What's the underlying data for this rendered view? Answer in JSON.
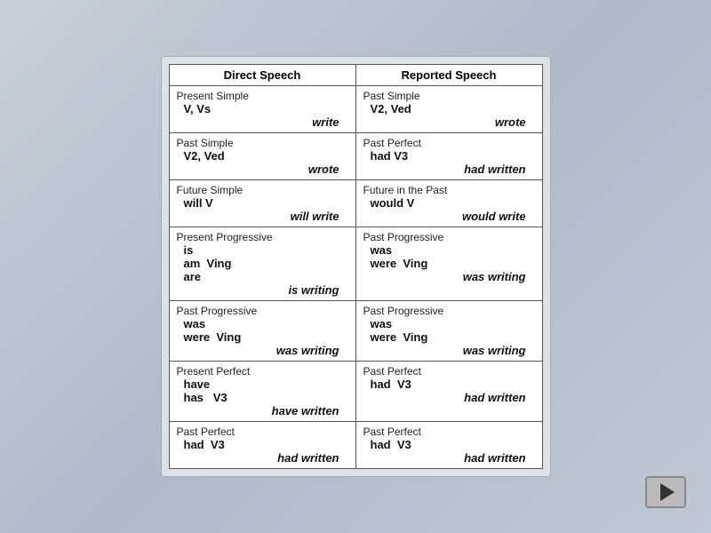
{
  "header": {
    "direct_speech": "Direct Speech",
    "reported_speech": "Reported Speech"
  },
  "rows": [
    {
      "direct_label": "Present Simple",
      "direct_form": "V, Vs",
      "direct_example": "write",
      "reported_label": "Past Simple",
      "reported_form": "V2, Ved",
      "reported_example": "wrote"
    },
    {
      "direct_label": "Past Simple",
      "direct_form": "V2, Ved",
      "direct_example": "wrote",
      "reported_label": "Past Perfect",
      "reported_form": "had V3",
      "reported_example": "had written"
    },
    {
      "direct_label": "Future Simple",
      "direct_form": "will V",
      "direct_example": "will write",
      "reported_label": "Future in the Past",
      "reported_form": "would V",
      "reported_example": "would write"
    },
    {
      "direct_label": "Present Progressive",
      "direct_form": "is\nam  Ving\nare",
      "direct_example": "is writing",
      "reported_label": "Past Progressive",
      "reported_form": "was\nwere  Ving",
      "reported_example": "was writing"
    },
    {
      "direct_label": "Past Progressive",
      "direct_form": "was\nwere  Ving",
      "direct_example": "was writing",
      "reported_label": "Past Progressive",
      "reported_form": "was\nwere  Ving",
      "reported_example": "was writing"
    },
    {
      "direct_label": "Present Perfect",
      "direct_form": "have\nhas   V3",
      "direct_example": "have written",
      "reported_label": "Past Perfect",
      "reported_form": "had  V3",
      "reported_example": "had written"
    },
    {
      "direct_label": "Past Perfect",
      "direct_form": "had  V3",
      "direct_example": "had written",
      "reported_label": "Past Perfect",
      "reported_form": "had  V3",
      "reported_example": "had written"
    }
  ],
  "play_button_label": "▶"
}
